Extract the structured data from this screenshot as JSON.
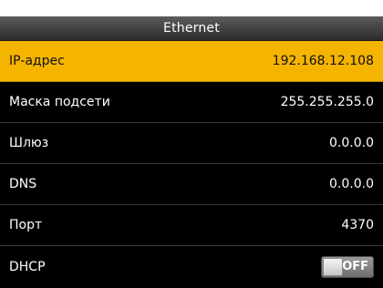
{
  "title": "Ethernet",
  "colors": {
    "selected_row": "#f5b400",
    "background": "#000000"
  },
  "rows": [
    {
      "label": "IP-адрес",
      "value": "192.168.12.108"
    },
    {
      "label": "Маска подсети",
      "value": "255.255.255.0"
    },
    {
      "label": "Шлюз",
      "value": "0.0.0.0"
    },
    {
      "label": "DNS",
      "value": "0.0.0.0"
    },
    {
      "label": "Порт",
      "value": "4370"
    },
    {
      "label": "DHCP",
      "toggle_label": "OFF",
      "toggle_state": "off"
    }
  ]
}
